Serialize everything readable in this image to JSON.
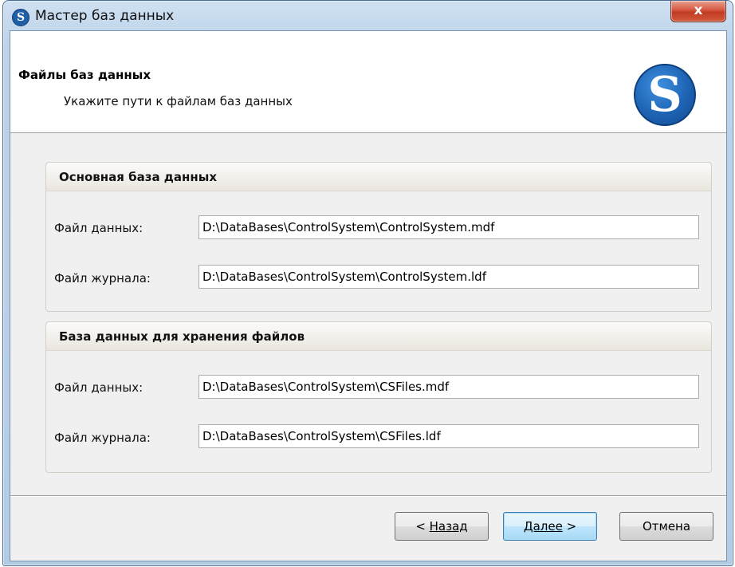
{
  "window": {
    "title": "Мастер баз данных",
    "close_glyph": "x"
  },
  "header": {
    "title": "Файлы баз данных",
    "subtitle": "Укажите пути к файлам баз данных",
    "logo_glyph": "S"
  },
  "groups": [
    {
      "title": "Основная база данных",
      "data_file_label": "Файл данных:",
      "data_file_value": "D:\\DataBases\\ControlSystem\\ControlSystem.mdf",
      "log_file_label": "Файл журнала:",
      "log_file_value": "D:\\DataBases\\ControlSystem\\ControlSystem.ldf"
    },
    {
      "title": "База данных для хранения файлов",
      "data_file_label": "Файл данных:",
      "data_file_value": "D:\\DataBases\\ControlSystem\\CSFiles.mdf",
      "log_file_label": "Файл журнала:",
      "log_file_value": "D:\\DataBases\\ControlSystem\\CSFiles.ldf"
    }
  ],
  "buttons": {
    "back_prefix": "< ",
    "back_label": "Назад",
    "next_label": "Далее",
    "next_suffix": " >",
    "cancel_label": "Отмена"
  },
  "colors": {
    "accent": "#1e63b4",
    "close_button": "#c03b24"
  }
}
